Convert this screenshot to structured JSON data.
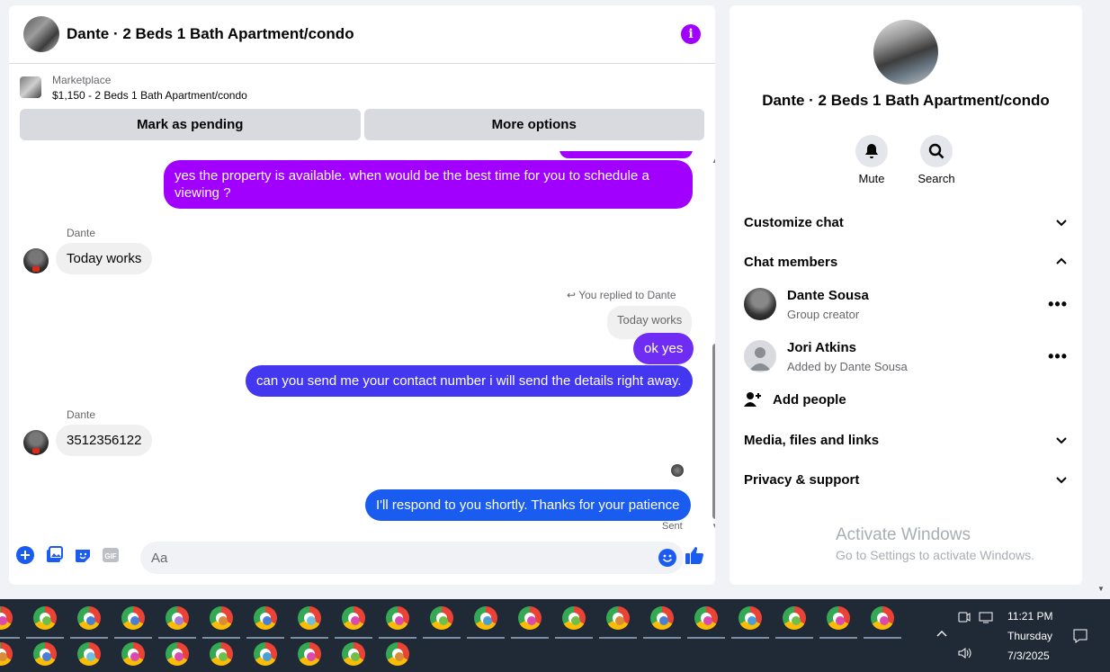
{
  "chat": {
    "title": "Dante · 2 Beds 1 Bath Apartment/condo",
    "marketplace_label": "Marketplace",
    "listing": "$1,150 - 2 Beds 1 Bath Apartment/condo",
    "mark_pending": "Mark as pending",
    "more_options": "More options",
    "messages": {
      "m1": "yes the property is available. when would be the best time for you to schedule a viewing ?",
      "sender1": "Dante",
      "m2": "Today works",
      "reply_note": "You replied to Dante",
      "quoted": "Today works",
      "m3": "ok yes",
      "m4": "can you send me your contact number i will send the details right away.",
      "sender2": "Dante",
      "m5": "3512356122",
      "m6": "I'll respond to you shortly. Thanks for your patience",
      "status": "Sent"
    },
    "composer_placeholder": "Aa"
  },
  "info": {
    "title": "Dante · 2 Beds 1 Bath Apartment/condo",
    "mute": "Mute",
    "search": "Search",
    "customize": "Customize chat",
    "members_header": "Chat members",
    "members": [
      {
        "name": "Dante Sousa",
        "role": "Group creator"
      },
      {
        "name": "Jori Atkins",
        "role": "Added by Dante Sousa"
      }
    ],
    "add_people": "Add people",
    "media": "Media, files and links",
    "privacy": "Privacy & support"
  },
  "watermark": {
    "line1": "Activate Windows",
    "line2": "Go to Settings to activate Windows."
  },
  "taskbar": {
    "time": "11:21 PM",
    "day": "Thursday",
    "date": "7/3/2025"
  },
  "colors": {
    "accent_purple": "#a100ff",
    "accent_blue": "#1a5cf0",
    "taskbar": "#202a36"
  }
}
